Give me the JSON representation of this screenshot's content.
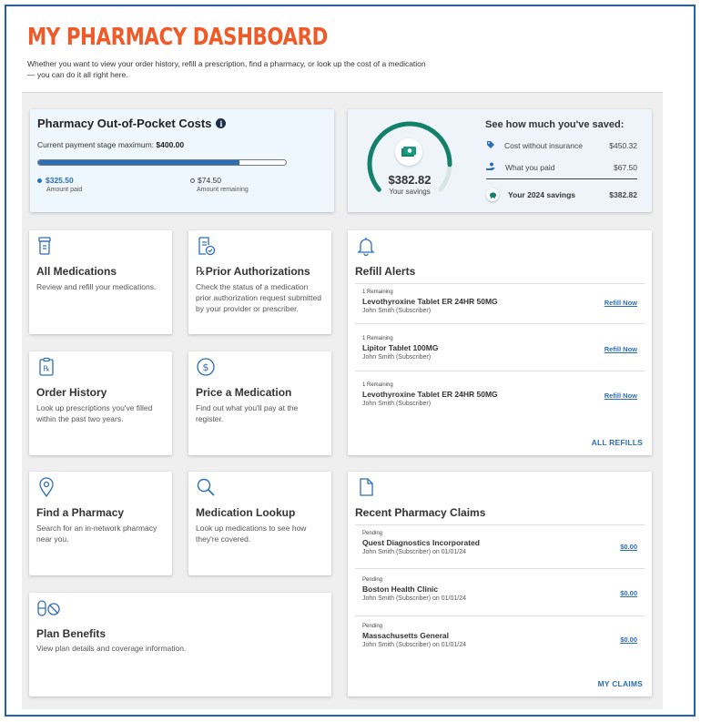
{
  "header": {
    "title": "MY PHARMACY DASHBOARD",
    "intro": "Whether you want to view your order history, refill a prescription, find a pharmacy, or look up the cost of a medication — you can do it all right here."
  },
  "out_of_pocket": {
    "title": "Pharmacy Out-of-Pocket Costs",
    "stage_label": "Current payment stage maximum:",
    "stage_max": "$400.00",
    "progress_fraction": 0.814,
    "amount_paid": "$325.50",
    "amount_paid_label": "Amount paid",
    "amount_remaining": "$74.50",
    "amount_remaining_label": "Amount remaining",
    "info_icon": "info-icon"
  },
  "savings": {
    "amount": "$382.82",
    "amount_label": "Your savings",
    "title": "See how much you've saved:",
    "gauge_fraction": 0.85,
    "rows": [
      {
        "label": "Cost without insurance",
        "value": "$450.32",
        "icon": "tag-icon"
      },
      {
        "label": "What you paid",
        "value": "$67.50",
        "icon": "hand-coin-icon"
      },
      {
        "label": "Your 2024 savings",
        "value": "$382.82",
        "icon": "piggy-bank-icon"
      }
    ]
  },
  "tiles": [
    {
      "name": "All Medications",
      "desc": "Review and refill your medications.",
      "icon": "pill-bottle-icon"
    },
    {
      "name": "Prior Authorizations",
      "prefix": "℞",
      "desc": "Check the status of a medication prior authorization request submitted by your provider or prescriber.",
      "icon": "document-check-icon"
    },
    {
      "name": "Order History",
      "desc": "Look up prescriptions you've filled within the past two years.",
      "icon": "clipboard-rx-icon"
    },
    {
      "name": "Price a Medication",
      "desc": "Find out what you'll pay at the register.",
      "icon": "dollar-circle-icon"
    },
    {
      "name": "Find a Pharmacy",
      "desc": "Search for an in-network pharmacy near you.",
      "icon": "location-pin-icon"
    },
    {
      "name": "Medication Lookup",
      "desc": "Look up medications to see how they're covered.",
      "icon": "magnifier-icon"
    },
    {
      "name": "Plan Benefits",
      "desc": "View plan details and coverage information.",
      "icon": "pill-ban-icon"
    }
  ],
  "refill_alerts": {
    "title": "Refill Alerts",
    "icon": "bell-icon",
    "items": [
      {
        "status": "1 Remaining",
        "name": "Levothyroxine Tablet ER 24HR 50MG",
        "subscriber": "John Smith (Subscriber)",
        "action": "Refill Now"
      },
      {
        "status": "1 Remaining",
        "name": "Lipitor Tablet 100MG",
        "subscriber": "John Smith (Subscriber)",
        "action": "Refill Now"
      },
      {
        "status": "1 Remaining",
        "name": "Levothyroxine Tablet ER 24HR 50MG",
        "subscriber": "John Smith (Subscriber)",
        "action": "Refill Now"
      }
    ],
    "footer": "ALL REFILLS"
  },
  "claims": {
    "title": "Recent Pharmacy Claims",
    "icon": "document-icon",
    "items": [
      {
        "status": "Pending",
        "name": "Quest Diagnostics Incorporated",
        "subscriber": "John Smith (Subscriber) on 01/01/24",
        "amount": "$0.00"
      },
      {
        "status": "Pending",
        "name": "Boston Health Clinic",
        "subscriber": "John Smith (Subscriber) on 01/01/24",
        "amount": "$0.00"
      },
      {
        "status": "Pending",
        "name": "Massachusetts General",
        "subscriber": "John Smith (Subscriber) on 01/01/24",
        "amount": "$0.00"
      }
    ],
    "footer": "MY CLAIMS"
  },
  "colors": {
    "title": "#f05a28",
    "accent": "#2c6eb6",
    "gauge": "#12806a",
    "frame": "#1f62b5"
  }
}
